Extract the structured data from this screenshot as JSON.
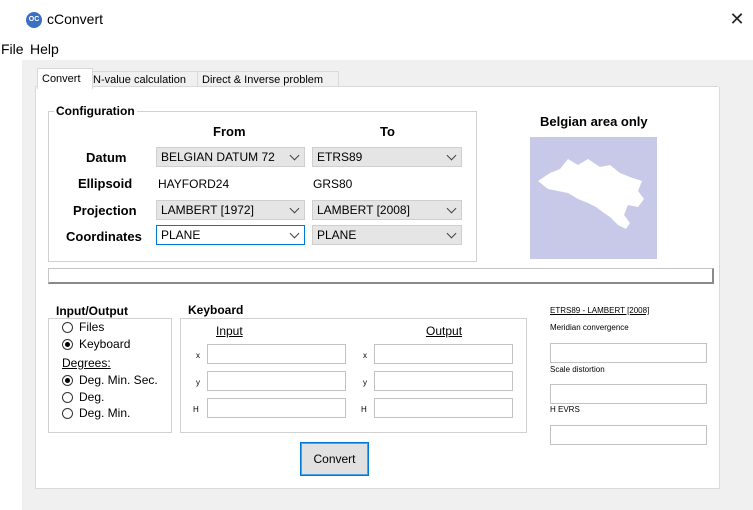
{
  "window": {
    "app_icon_text": "OC",
    "title": "cConvert",
    "close_symbol": "✕"
  },
  "menu": [
    "File",
    "Help"
  ],
  "tabs": [
    "Convert",
    "N-value calculation",
    "Direct & Inverse problem"
  ],
  "configuration": {
    "title": "Configuration",
    "from_header": "From",
    "to_header": "To",
    "rows": [
      {
        "label": "Datum",
        "from": "BELGIAN DATUM 72",
        "to": "ETRS89"
      },
      {
        "label": "Ellipsoid",
        "from": "HAYFORD24",
        "to": "GRS80"
      },
      {
        "label": "Projection",
        "from": "LAMBERT [1972]",
        "to": "LAMBERT [2008]"
      },
      {
        "label": "Coordinates",
        "from": "PLANE",
        "to": "PLANE"
      }
    ]
  },
  "map": {
    "caption": "Belgian area only",
    "fill_color": "#c8c8e8"
  },
  "io": {
    "title": "Input/Output",
    "files": "Files",
    "keyboard": "Keyboard",
    "degrees_label": "Degrees:",
    "deg_min_sec": "Deg. Min. Sec.",
    "deg": "Deg.",
    "deg_min": "Deg. Min.",
    "selected_mode": "Keyboard",
    "selected_degrees": "Deg. Min. Sec."
  },
  "keyboard": {
    "title": "Keyboard",
    "input_header": "Input",
    "output_header": "Output",
    "rows": [
      "x",
      "y",
      "H"
    ]
  },
  "results": {
    "link": "ETRS89 - LAMBERT [2008]",
    "meridian": "Meridian convergence",
    "scale": "Scale distortion",
    "hevrs": "H EVRS"
  },
  "convert_button": "Convert",
  "colors": {
    "accent": "#0078d7",
    "tab_border": "#d9d9d9"
  }
}
